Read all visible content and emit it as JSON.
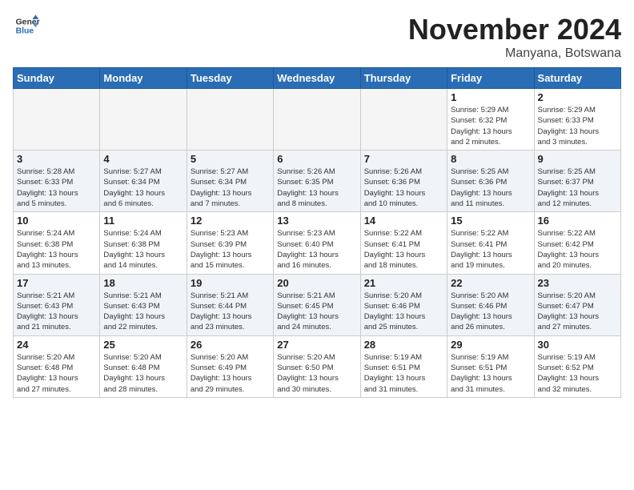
{
  "header": {
    "logo_general": "General",
    "logo_blue": "Blue",
    "month_title": "November 2024",
    "location": "Manyana, Botswana"
  },
  "weekdays": [
    "Sunday",
    "Monday",
    "Tuesday",
    "Wednesday",
    "Thursday",
    "Friday",
    "Saturday"
  ],
  "weeks": [
    [
      {
        "day": "",
        "info": ""
      },
      {
        "day": "",
        "info": ""
      },
      {
        "day": "",
        "info": ""
      },
      {
        "day": "",
        "info": ""
      },
      {
        "day": "",
        "info": ""
      },
      {
        "day": "1",
        "info": "Sunrise: 5:29 AM\nSunset: 6:32 PM\nDaylight: 13 hours\nand 2 minutes."
      },
      {
        "day": "2",
        "info": "Sunrise: 5:29 AM\nSunset: 6:33 PM\nDaylight: 13 hours\nand 3 minutes."
      }
    ],
    [
      {
        "day": "3",
        "info": "Sunrise: 5:28 AM\nSunset: 6:33 PM\nDaylight: 13 hours\nand 5 minutes."
      },
      {
        "day": "4",
        "info": "Sunrise: 5:27 AM\nSunset: 6:34 PM\nDaylight: 13 hours\nand 6 minutes."
      },
      {
        "day": "5",
        "info": "Sunrise: 5:27 AM\nSunset: 6:34 PM\nDaylight: 13 hours\nand 7 minutes."
      },
      {
        "day": "6",
        "info": "Sunrise: 5:26 AM\nSunset: 6:35 PM\nDaylight: 13 hours\nand 8 minutes."
      },
      {
        "day": "7",
        "info": "Sunrise: 5:26 AM\nSunset: 6:36 PM\nDaylight: 13 hours\nand 10 minutes."
      },
      {
        "day": "8",
        "info": "Sunrise: 5:25 AM\nSunset: 6:36 PM\nDaylight: 13 hours\nand 11 minutes."
      },
      {
        "day": "9",
        "info": "Sunrise: 5:25 AM\nSunset: 6:37 PM\nDaylight: 13 hours\nand 12 minutes."
      }
    ],
    [
      {
        "day": "10",
        "info": "Sunrise: 5:24 AM\nSunset: 6:38 PM\nDaylight: 13 hours\nand 13 minutes."
      },
      {
        "day": "11",
        "info": "Sunrise: 5:24 AM\nSunset: 6:38 PM\nDaylight: 13 hours\nand 14 minutes."
      },
      {
        "day": "12",
        "info": "Sunrise: 5:23 AM\nSunset: 6:39 PM\nDaylight: 13 hours\nand 15 minutes."
      },
      {
        "day": "13",
        "info": "Sunrise: 5:23 AM\nSunset: 6:40 PM\nDaylight: 13 hours\nand 16 minutes."
      },
      {
        "day": "14",
        "info": "Sunrise: 5:22 AM\nSunset: 6:41 PM\nDaylight: 13 hours\nand 18 minutes."
      },
      {
        "day": "15",
        "info": "Sunrise: 5:22 AM\nSunset: 6:41 PM\nDaylight: 13 hours\nand 19 minutes."
      },
      {
        "day": "16",
        "info": "Sunrise: 5:22 AM\nSunset: 6:42 PM\nDaylight: 13 hours\nand 20 minutes."
      }
    ],
    [
      {
        "day": "17",
        "info": "Sunrise: 5:21 AM\nSunset: 6:43 PM\nDaylight: 13 hours\nand 21 minutes."
      },
      {
        "day": "18",
        "info": "Sunrise: 5:21 AM\nSunset: 6:43 PM\nDaylight: 13 hours\nand 22 minutes."
      },
      {
        "day": "19",
        "info": "Sunrise: 5:21 AM\nSunset: 6:44 PM\nDaylight: 13 hours\nand 23 minutes."
      },
      {
        "day": "20",
        "info": "Sunrise: 5:21 AM\nSunset: 6:45 PM\nDaylight: 13 hours\nand 24 minutes."
      },
      {
        "day": "21",
        "info": "Sunrise: 5:20 AM\nSunset: 6:46 PM\nDaylight: 13 hours\nand 25 minutes."
      },
      {
        "day": "22",
        "info": "Sunrise: 5:20 AM\nSunset: 6:46 PM\nDaylight: 13 hours\nand 26 minutes."
      },
      {
        "day": "23",
        "info": "Sunrise: 5:20 AM\nSunset: 6:47 PM\nDaylight: 13 hours\nand 27 minutes."
      }
    ],
    [
      {
        "day": "24",
        "info": "Sunrise: 5:20 AM\nSunset: 6:48 PM\nDaylight: 13 hours\nand 27 minutes."
      },
      {
        "day": "25",
        "info": "Sunrise: 5:20 AM\nSunset: 6:48 PM\nDaylight: 13 hours\nand 28 minutes."
      },
      {
        "day": "26",
        "info": "Sunrise: 5:20 AM\nSunset: 6:49 PM\nDaylight: 13 hours\nand 29 minutes."
      },
      {
        "day": "27",
        "info": "Sunrise: 5:20 AM\nSunset: 6:50 PM\nDaylight: 13 hours\nand 30 minutes."
      },
      {
        "day": "28",
        "info": "Sunrise: 5:19 AM\nSunset: 6:51 PM\nDaylight: 13 hours\nand 31 minutes."
      },
      {
        "day": "29",
        "info": "Sunrise: 5:19 AM\nSunset: 6:51 PM\nDaylight: 13 hours\nand 31 minutes."
      },
      {
        "day": "30",
        "info": "Sunrise: 5:19 AM\nSunset: 6:52 PM\nDaylight: 13 hours\nand 32 minutes."
      }
    ]
  ]
}
